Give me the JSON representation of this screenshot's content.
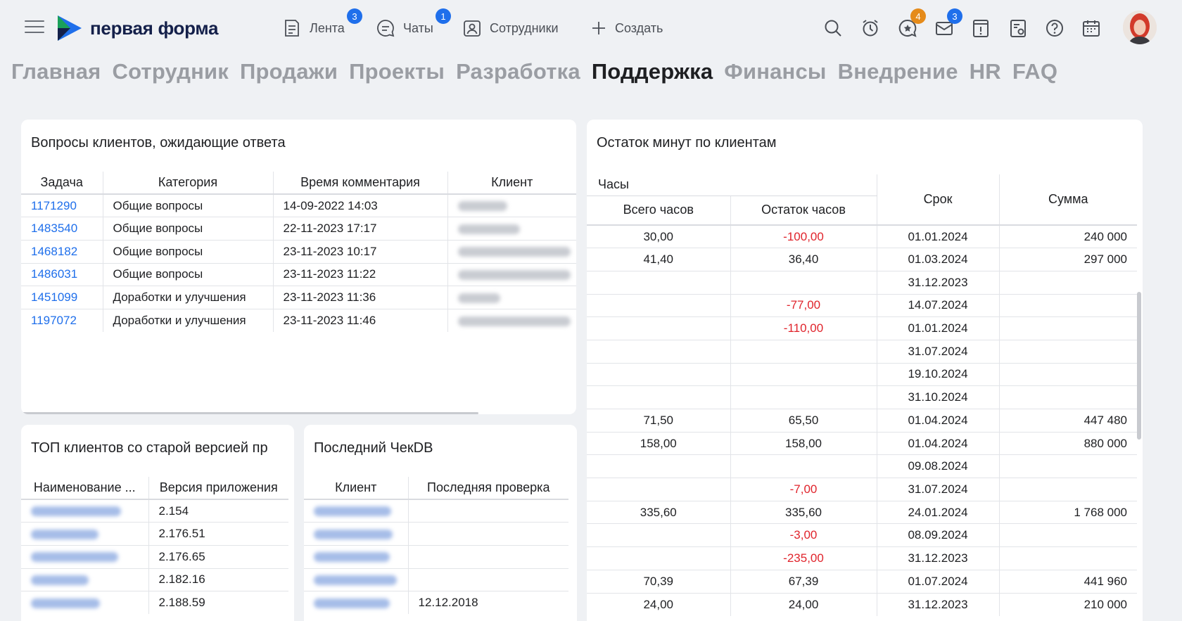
{
  "header": {
    "logo_text": "первая форма",
    "nav": [
      {
        "label": "Лента",
        "badge": "3",
        "icon": "feed-icon"
      },
      {
        "label": "Чаты",
        "badge": "1",
        "icon": "chat-icon"
      },
      {
        "label": "Сотрудники",
        "icon": "employees-icon"
      },
      {
        "label": "Создать",
        "icon": "plus-icon"
      }
    ],
    "toolbar_icons": [
      {
        "name": "search-icon"
      },
      {
        "name": "alarm-clock-icon"
      },
      {
        "name": "favorites-icon",
        "badge": "4",
        "badge_color": "#e58b1a"
      },
      {
        "name": "notifications-icon",
        "badge": "3",
        "badge_color": "#1f6feb"
      },
      {
        "name": "important-icon"
      },
      {
        "name": "settings-document-icon"
      },
      {
        "name": "help-icon"
      },
      {
        "name": "calendar-icon"
      }
    ]
  },
  "tabs": [
    "Главная",
    "Сотрудник",
    "Продажи",
    "Проекты",
    "Разработка",
    "Поддержка",
    "Финансы",
    "Внедрение",
    "HR",
    "FAQ"
  ],
  "active_tab": "Поддержка",
  "questions": {
    "title": "Вопросы клиентов, ожидающие ответа",
    "columns": [
      "Задача",
      "Категория",
      "Время комментария",
      "Клиент"
    ],
    "rows": [
      {
        "task": "1171290",
        "category": "Общие вопросы",
        "time": "14-09-2022 14:03"
      },
      {
        "task": "1483540",
        "category": "Общие вопросы",
        "time": "22-11-2023 17:17"
      },
      {
        "task": "1468182",
        "category": "Общие вопросы",
        "time": "23-11-2023 10:17"
      },
      {
        "task": "1486031",
        "category": "Общие вопросы",
        "time": "23-11-2023 11:22"
      },
      {
        "task": "1451099",
        "category": "Доработки и улучшения",
        "time": "23-11-2023 11:36"
      },
      {
        "task": "1197072",
        "category": "Доработки и улучшения",
        "time": "23-11-2023 11:46"
      }
    ]
  },
  "minutes": {
    "title": "Остаток минут по клиентам",
    "group_header": "Часы",
    "columns": [
      "Всего часов",
      "Остаток часов",
      "Срок",
      "Сумма"
    ],
    "rows": [
      {
        "total": "30,00",
        "remain": "-100,00",
        "due": "01.01.2024",
        "sum": "240 000"
      },
      {
        "total": "41,40",
        "remain": "36,40",
        "due": "01.03.2024",
        "sum": "297 000"
      },
      {
        "total": "",
        "remain": "",
        "due": "31.12.2023",
        "sum": ""
      },
      {
        "total": "",
        "remain": "-77,00",
        "due": "14.07.2024",
        "sum": ""
      },
      {
        "total": "",
        "remain": "-110,00",
        "due": "01.01.2024",
        "sum": ""
      },
      {
        "total": "",
        "remain": "",
        "due": "31.07.2024",
        "sum": ""
      },
      {
        "total": "",
        "remain": "",
        "due": "19.10.2024",
        "sum": ""
      },
      {
        "total": "",
        "remain": "",
        "due": "31.10.2024",
        "sum": ""
      },
      {
        "total": "71,50",
        "remain": "65,50",
        "due": "01.04.2024",
        "sum": "447 480"
      },
      {
        "total": "158,00",
        "remain": "158,00",
        "due": "01.04.2024",
        "sum": "880 000"
      },
      {
        "total": "",
        "remain": "",
        "due": "09.08.2024",
        "sum": ""
      },
      {
        "total": "",
        "remain": "-7,00",
        "due": "31.07.2024",
        "sum": ""
      },
      {
        "total": "335,60",
        "remain": "335,60",
        "due": "24.01.2024",
        "sum": "1 768 000"
      },
      {
        "total": "",
        "remain": "-3,00",
        "due": "08.09.2024",
        "sum": ""
      },
      {
        "total": "",
        "remain": "-235,00",
        "due": "31.12.2023",
        "sum": ""
      },
      {
        "total": "70,39",
        "remain": "67,39",
        "due": "01.07.2024",
        "sum": "441 960"
      },
      {
        "total": "24,00",
        "remain": "24,00",
        "due": "31.12.2023",
        "sum": "210 000"
      }
    ]
  },
  "top_clients": {
    "title": "ТОП клиентов со старой версией пр",
    "columns": [
      "Наименование ...",
      "Версия приложения"
    ],
    "versions": [
      "2.154",
      "2.176.51",
      "2.176.65",
      "2.182.16",
      "2.188.59"
    ]
  },
  "checkdb": {
    "title": "Последний ЧекDB",
    "columns": [
      "Клиент",
      "Последняя проверка"
    ],
    "last_checks": [
      "",
      "",
      "",
      "",
      "12.12.2018"
    ]
  },
  "colors": {
    "accent": "#1f6feb",
    "negative": "#e0242c",
    "badge_orange": "#e58b1a"
  }
}
